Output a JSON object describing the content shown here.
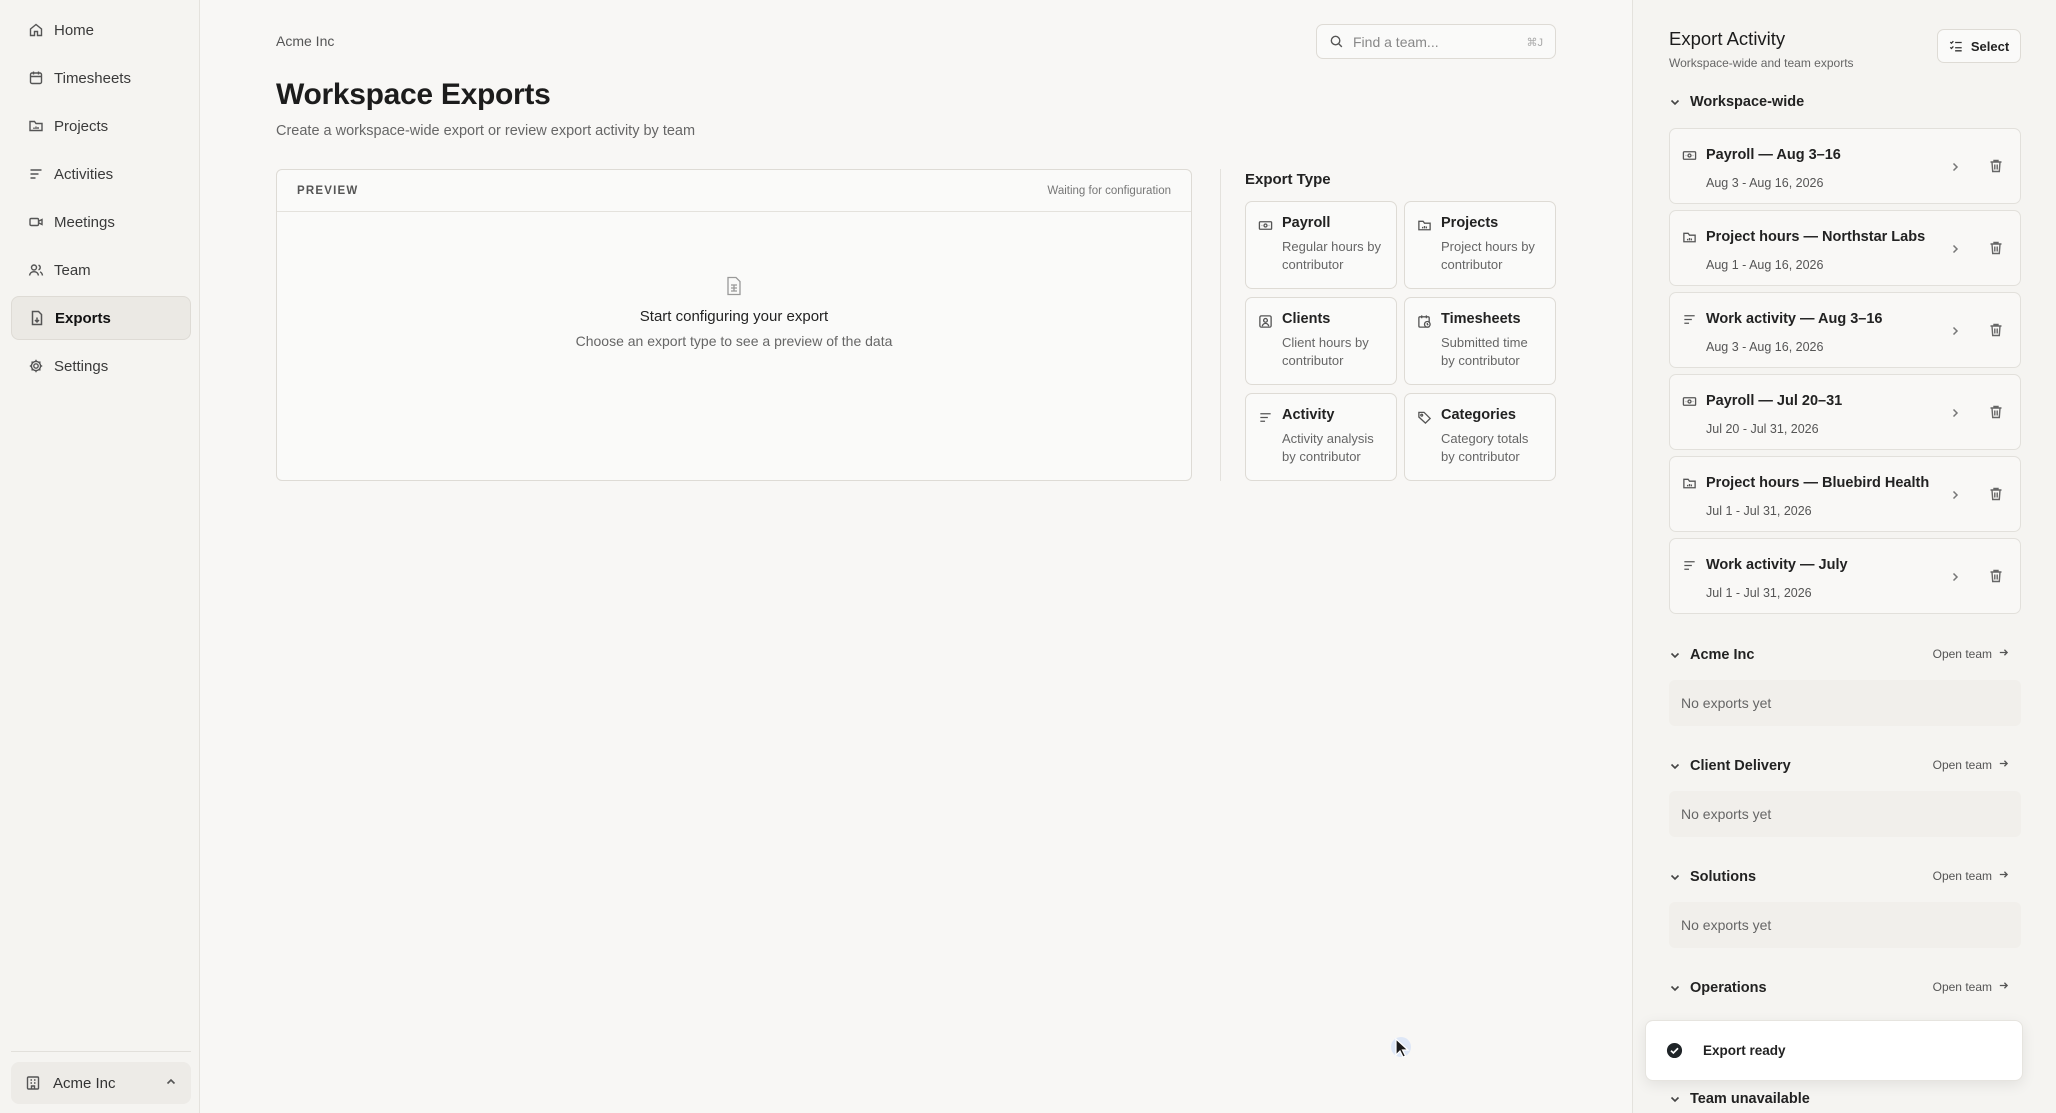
{
  "sidebar": {
    "items": [
      {
        "label": "Home",
        "icon": "home-icon"
      },
      {
        "label": "Timesheets",
        "icon": "calendar-icon"
      },
      {
        "label": "Projects",
        "icon": "folder-icon"
      },
      {
        "label": "Activities",
        "icon": "activity-lines-icon"
      },
      {
        "label": "Meetings",
        "icon": "video-icon"
      },
      {
        "label": "Team",
        "icon": "users-icon"
      },
      {
        "label": "Exports",
        "icon": "file-export-icon",
        "active": true
      },
      {
        "label": "Settings",
        "icon": "gear-icon"
      }
    ],
    "workspace": "Acme Inc"
  },
  "main": {
    "breadcrumb": "Acme Inc",
    "search": {
      "placeholder": "Find a team...",
      "shortcut": "⌘J"
    },
    "title": "Workspace Exports",
    "subtitle": "Create a workspace-wide export or review export activity by team",
    "preview": {
      "label": "PREVIEW",
      "status": "Waiting for configuration",
      "empty_title": "Start configuring your export",
      "empty_sub": "Choose an export type to see a preview of the data"
    },
    "export_type": {
      "title": "Export Type",
      "cards": [
        {
          "title": "Payroll",
          "desc": "Regular hours by contributor",
          "icon": "money-icon"
        },
        {
          "title": "Projects",
          "desc": "Project hours by contributor",
          "icon": "folder-icon"
        },
        {
          "title": "Clients",
          "desc": "Client hours by contributor",
          "icon": "client-icon"
        },
        {
          "title": "Timesheets",
          "desc": "Submitted time by contributor",
          "icon": "timesheet-icon"
        },
        {
          "title": "Activity",
          "desc": "Activity analysis by contributor",
          "icon": "activity-lines-icon"
        },
        {
          "title": "Categories",
          "desc": "Category totals by contributor",
          "icon": "tag-icon"
        }
      ]
    }
  },
  "panel": {
    "title": "Export Activity",
    "subtitle": "Workspace-wide and team exports",
    "select_label": "Select",
    "workspace_group": "Workspace-wide",
    "exports": [
      {
        "title": "Payroll — Aug 3–16",
        "date": "Aug 3 - Aug 16, 2026",
        "icon": "money-icon"
      },
      {
        "title": "Project hours — Northstar Labs",
        "date": "Aug 1 - Aug 16, 2026",
        "icon": "folder-icon"
      },
      {
        "title": "Work activity — Aug 3–16",
        "date": "Aug 3 - Aug 16, 2026",
        "icon": "activity-lines-icon"
      },
      {
        "title": "Payroll — Jul 20–31",
        "date": "Jul 20 - Jul 31, 2026",
        "icon": "money-icon"
      },
      {
        "title": "Project hours — Bluebird Health",
        "date": "Jul 1 - Jul 31, 2026",
        "icon": "folder-icon"
      },
      {
        "title": "Work activity — July",
        "date": "Jul 1 - Jul 31, 2026",
        "icon": "activity-lines-icon"
      }
    ],
    "teams": [
      {
        "name": "Acme Inc",
        "open": "Open team",
        "empty": "No exports yet"
      },
      {
        "name": "Client Delivery",
        "open": "Open team",
        "empty": "No exports yet"
      },
      {
        "name": "Solutions",
        "open": "Open team",
        "empty": "No exports yet"
      },
      {
        "name": "Operations",
        "open": "Open team"
      },
      {
        "name": "Team unavailable"
      }
    ]
  },
  "toast": {
    "message": "Export ready"
  }
}
